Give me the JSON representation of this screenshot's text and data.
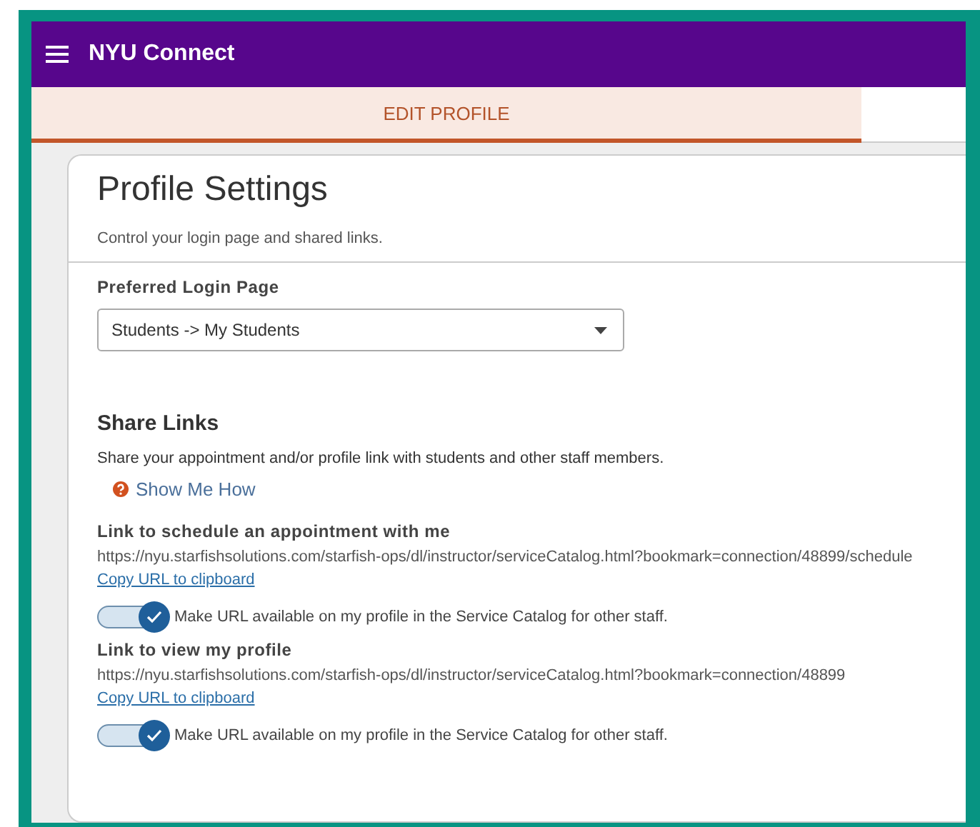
{
  "header": {
    "title": "NYU Connect"
  },
  "tabs": [
    {
      "label": "EDIT PROFILE",
      "selected": true
    }
  ],
  "card": {
    "title": "Profile Settings",
    "subtitle": "Control your login page and shared links.",
    "login": {
      "label": "Preferred Login Page",
      "value": "Students -> My Students"
    },
    "share": {
      "heading": "Share Links",
      "description": "Share your appointment and/or profile link with students and other staff members.",
      "help": "Show Me How",
      "links": [
        {
          "label": "Link to schedule an appointment with me",
          "url": "https://nyu.starfishsolutions.com/starfish-ops/dl/instructor/serviceCatalog.html?bookmark=connection/48899/schedule",
          "copy": "Copy URL to clipboard",
          "toggle_label": "Make URL available on my profile in the Service Catalog for other staff.",
          "on": true
        },
        {
          "label": "Link to view my profile",
          "url": "https://nyu.starfishsolutions.com/starfish-ops/dl/instructor/serviceCatalog.html?bookmark=connection/48899",
          "copy": "Copy URL to clipboard",
          "toggle_label": "Make URL available on my profile in the Service Catalog for other staff.",
          "on": true
        }
      ]
    }
  }
}
